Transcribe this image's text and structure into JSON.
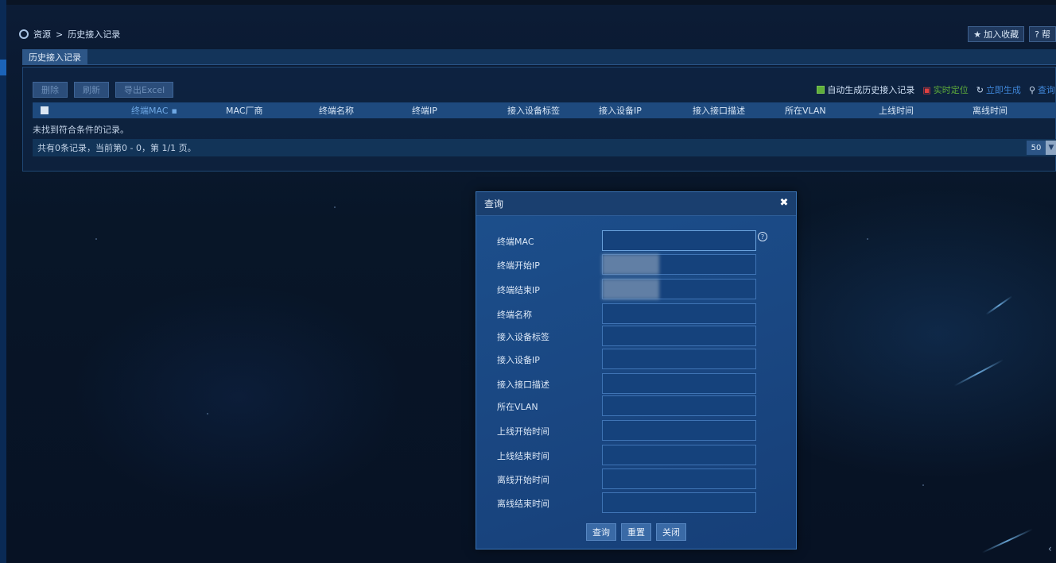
{
  "breadcrumb": {
    "root": "资源",
    "separator": ">",
    "current": "历史接入记录"
  },
  "header_actions": {
    "favorite_label": "加入收藏",
    "help_label": "帮"
  },
  "tab": {
    "label": "历史接入记录"
  },
  "toolbar": {
    "delete_label": "删除",
    "refresh_label": "刷新",
    "export_label": "导出Excel"
  },
  "right_tools": {
    "auto_generate_label": "自动生成历史接入记录",
    "realtime_locate_label": "实时定位",
    "generate_now_label": "立即生成",
    "query_label": "查询"
  },
  "table": {
    "columns": [
      "终端MAC",
      "MAC厂商",
      "终端名称",
      "终端IP",
      "接入设备标签",
      "接入设备IP",
      "接入接口描述",
      "所在VLAN",
      "上线时间",
      "离线时间"
    ],
    "empty_text": "未找到符合条件的记录。",
    "summary": "共有0条记录，当前第0 - 0，第 1/1 页。",
    "page_size": "50"
  },
  "dialog": {
    "title": "查询",
    "fields": [
      {
        "label": "终端MAC",
        "value": ""
      },
      {
        "label": "终端开始IP",
        "value": ""
      },
      {
        "label": "终端结束IP",
        "value": ""
      },
      {
        "label": "终端名称",
        "value": ""
      },
      {
        "label": "接入设备标签",
        "value": ""
      },
      {
        "label": "接入设备IP",
        "value": ""
      },
      {
        "label": "接入接口描述",
        "value": ""
      },
      {
        "label": "所在VLAN",
        "value": ""
      },
      {
        "label": "上线开始时间",
        "value": ""
      },
      {
        "label": "上线结束时间",
        "value": ""
      },
      {
        "label": "离线开始时间",
        "value": ""
      },
      {
        "label": "离线结束时间",
        "value": ""
      }
    ],
    "query_button": "查询",
    "reset_button": "重置",
    "close_button": "关闭"
  },
  "colors": {
    "background": "#081529",
    "panel": "#102a4c",
    "dialog": "#1c4f8c",
    "accent_green": "#5fae3a",
    "accent_blue": "#3f86d8"
  },
  "icons": [
    "refresh-icon",
    "star-icon",
    "help-icon",
    "checkbox-icon",
    "locate-icon",
    "search-icon",
    "close-icon",
    "chevron-down-icon"
  ]
}
